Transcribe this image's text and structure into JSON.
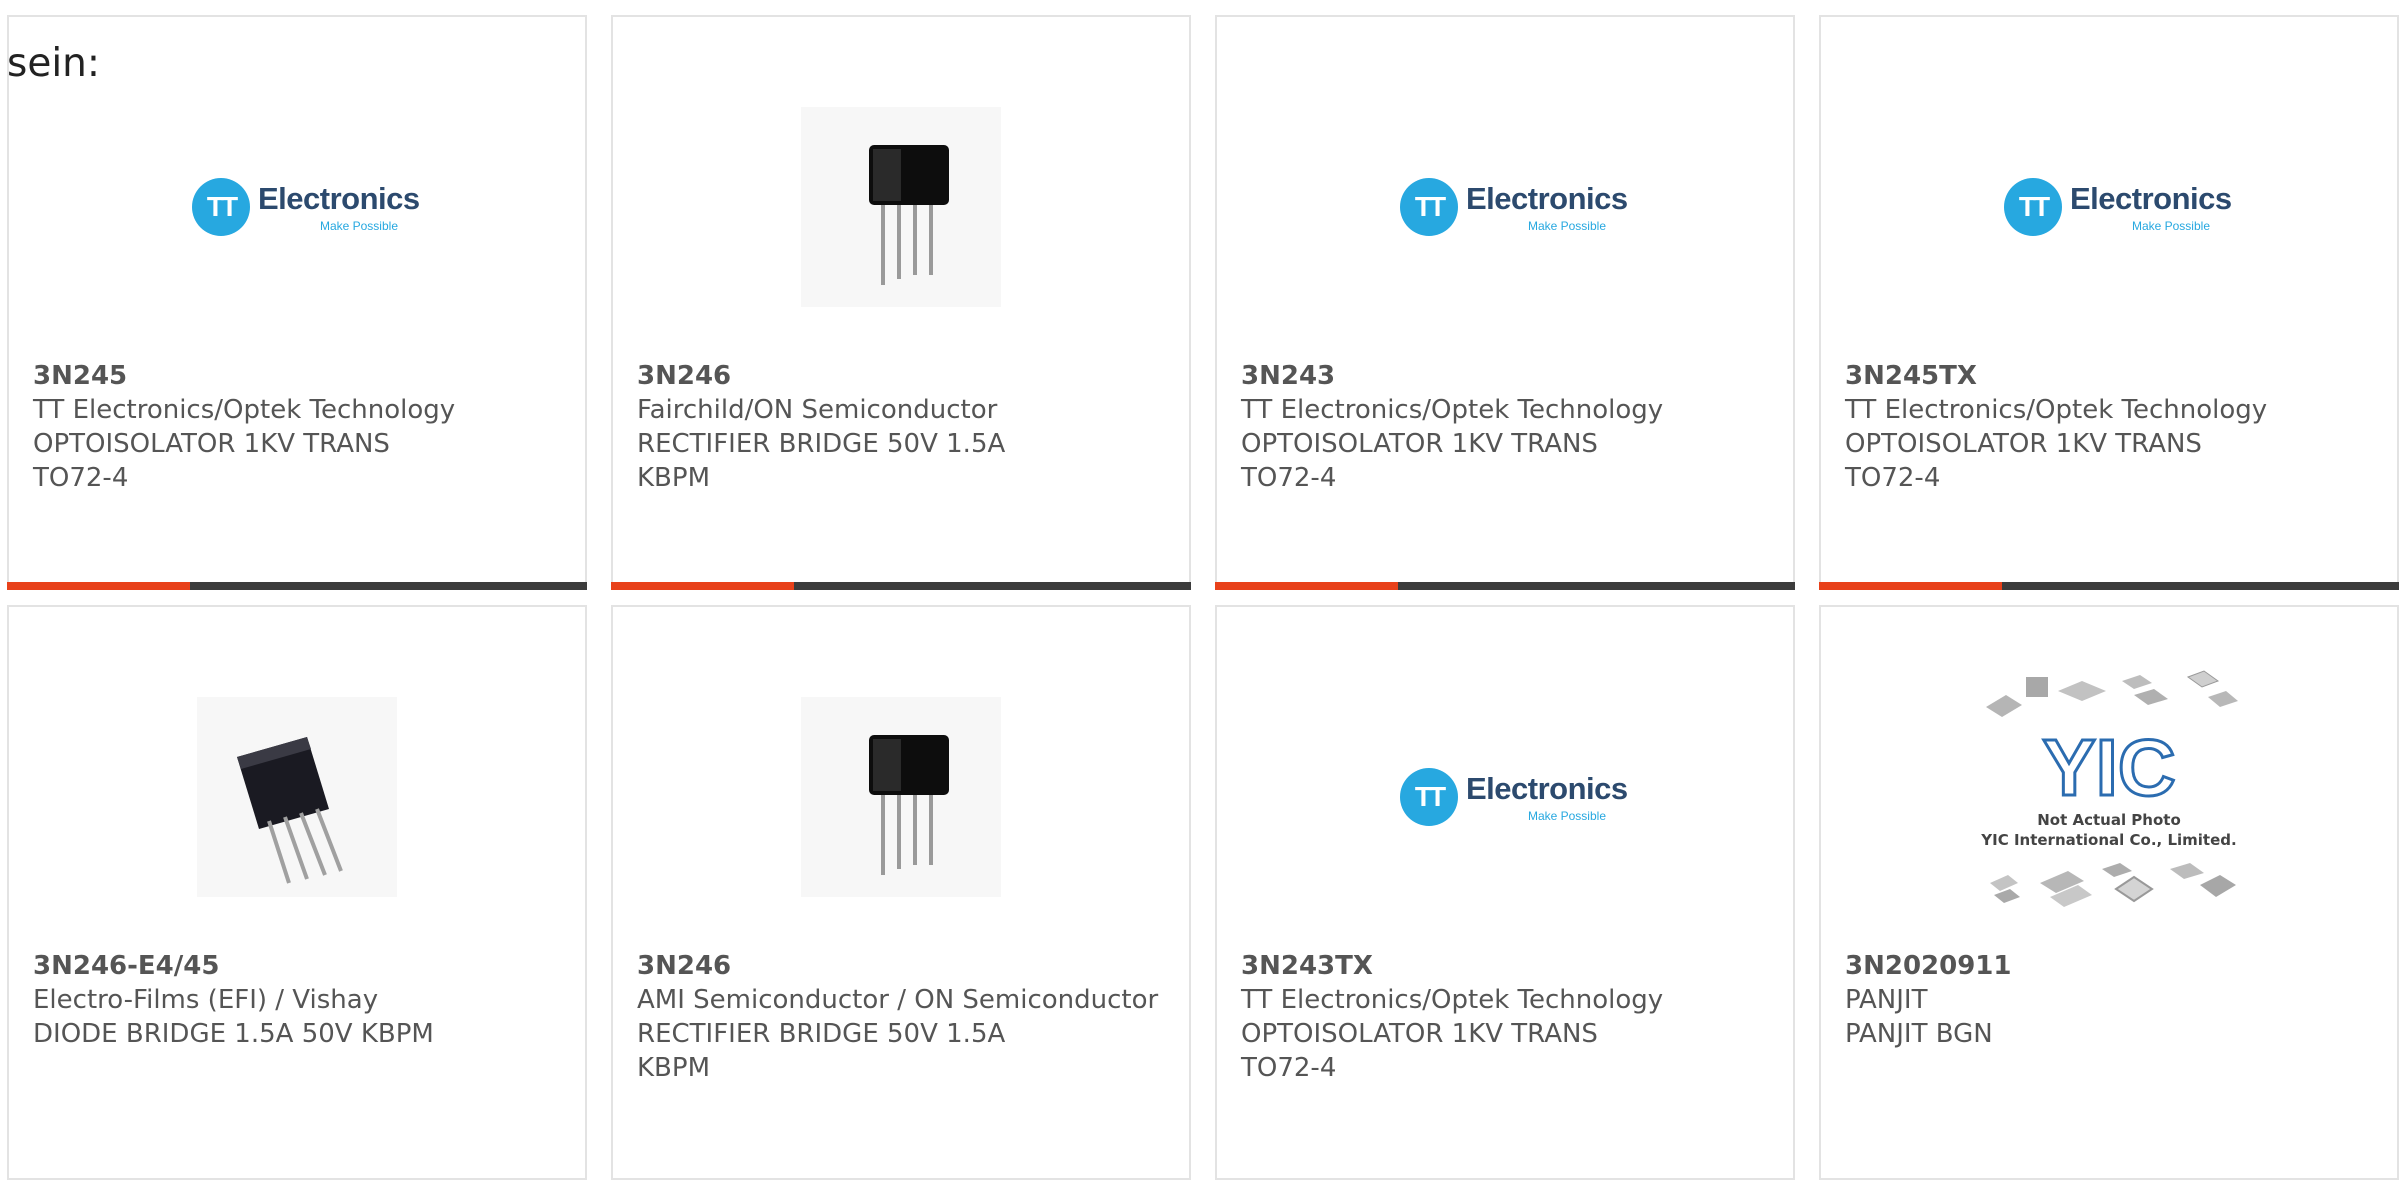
{
  "intro_text": "sein:",
  "logo": {
    "brand_word": "Electronics",
    "brand_initials": "TT",
    "tagline": "Make Possible"
  },
  "yic": {
    "line1": "Not Actual Photo",
    "line2": "YIC International Co., Limited.",
    "mark": "YIC"
  },
  "colors": {
    "accent": "#e8411a",
    "bar_dark": "#3c3c3c",
    "logo_blue": "#27a8e0",
    "text": "#555555"
  },
  "products": [
    {
      "part": "3N245",
      "mfr": "TT Electronics/Optek Technology",
      "desc_lines": [
        "OPTOISOLATOR 1KV TRANS",
        "TO72-4"
      ],
      "image": "tt-electronics-logo"
    },
    {
      "part": "3N246",
      "mfr": "Fairchild/ON Semiconductor",
      "desc_lines": [
        "RECTIFIER BRIDGE 50V 1.5A",
        "KBPM"
      ],
      "image": "rectifier-bridge-photo"
    },
    {
      "part": "3N243",
      "mfr": "TT Electronics/Optek Technology",
      "desc_lines": [
        "OPTOISOLATOR 1KV TRANS",
        "TO72-4"
      ],
      "image": "tt-electronics-logo"
    },
    {
      "part": "3N245TX",
      "mfr": "TT Electronics/Optek Technology",
      "desc_lines": [
        "OPTOISOLATOR 1KV TRANS",
        "TO72-4"
      ],
      "image": "tt-electronics-logo"
    },
    {
      "part": "3N246-E4/45",
      "mfr": "Electro-Films (EFI) / Vishay",
      "desc_lines": [
        "DIODE BRIDGE 1.5A 50V KBPM"
      ],
      "image": "diode-bridge-photo"
    },
    {
      "part": "3N246",
      "mfr": "AMI Semiconductor / ON Semiconductor",
      "desc_lines": [
        "RECTIFIER BRIDGE 50V 1.5A",
        "KBPM"
      ],
      "image": "rectifier-bridge-photo"
    },
    {
      "part": "3N243TX",
      "mfr": "TT Electronics/Optek Technology",
      "desc_lines": [
        "OPTOISOLATOR 1KV TRANS",
        "TO72-4"
      ],
      "image": "tt-electronics-logo"
    },
    {
      "part": "3N2020911",
      "mfr": "PANJIT",
      "desc_lines": [
        "PANJIT BGN"
      ],
      "image": "yic-not-actual-photo"
    }
  ]
}
